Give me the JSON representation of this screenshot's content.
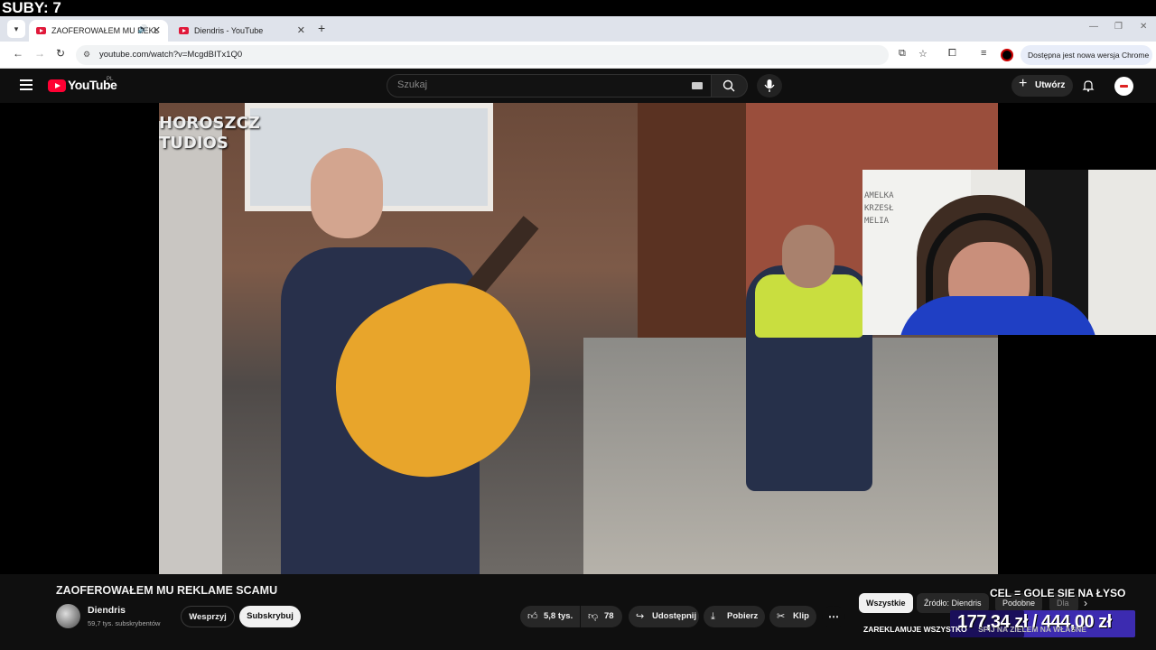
{
  "overlay": {
    "subs_counter": "SUBY: 7"
  },
  "browser": {
    "tabs": [
      {
        "title": "ZAOFEROWAŁEM MU REKL",
        "active": true
      },
      {
        "title": "Diendris - YouTube",
        "active": false
      }
    ],
    "url": "youtube.com/watch?v=McgdBITx1Q0",
    "update_pill": "Dostępna jest nowa wersja Chrome"
  },
  "youtube": {
    "logo_text": "YouTube",
    "region": "PL",
    "search_placeholder": "Szukaj",
    "create_label": "Utwórz"
  },
  "video": {
    "watermark_line1": "HOROSZCZ",
    "watermark_line2": "TUDIOS",
    "webcam_text": [
      "AMELKA",
      "KRZESŁ",
      "MELIA"
    ]
  },
  "meta": {
    "title": "ZAOFEROWAŁEM MU REKLAME SCAMU",
    "channel": "Diendris",
    "subscribers": "59,7 tys. subskrybentów",
    "join_label": "Wesprzyj",
    "subscribe_label": "Subskrybuj",
    "likes": "5,8 tys.",
    "dislikes": "78",
    "share_label": "Udostępnij",
    "download_label": "Pobierz",
    "clip_label": "Klip",
    "more_label": "⋯"
  },
  "chips": [
    "Wszystkie",
    "Źródło: Diendris",
    "Podobne",
    "Dla"
  ],
  "donation": {
    "goal_label": "CEL = GOLE SIE NA ŁYSO",
    "amount": "177,34 zł / 444,00 zł",
    "progress": 0.3994,
    "ticker_left": "ZAREKLAMUJE WSZYSTKO",
    "ticker_right": "SPIJ NA ZIELEM NA WŁASNE",
    "accent": "#3c2bb0"
  },
  "colors": {
    "yt_red": "#ff0033",
    "yt_bg": "#0f0f0f"
  }
}
